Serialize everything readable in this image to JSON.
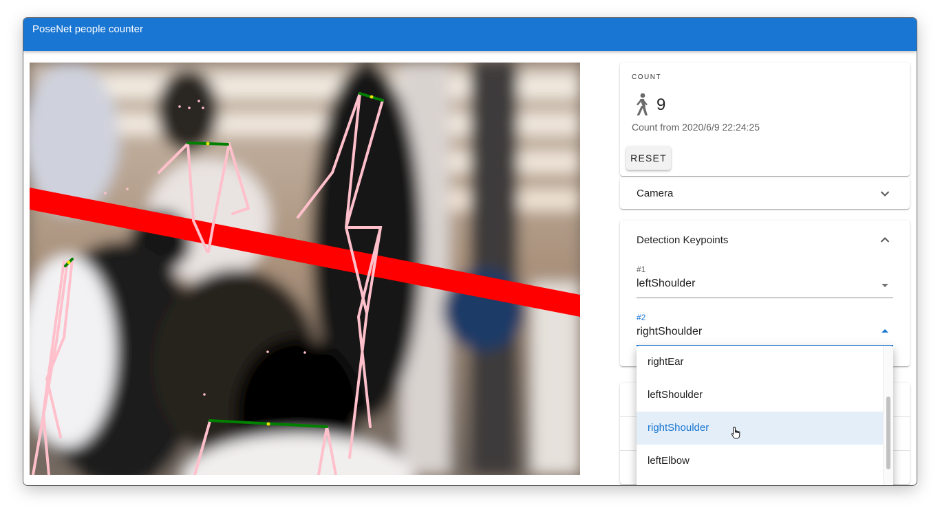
{
  "app": {
    "title": "PoseNet people counter"
  },
  "count_card": {
    "overline": "COUNT",
    "icon": "walking-person-icon",
    "count": "9",
    "count_from": "Count from 2020/6/9 22:24:25",
    "reset_label": "RESET"
  },
  "camera_section": {
    "title": "Camera",
    "expanded": false,
    "icon": "chevron-down-icon"
  },
  "keypoints_section": {
    "title": "Detection Keypoints",
    "expanded": true,
    "icon": "chevron-up-icon",
    "fields": [
      {
        "label": "#1",
        "value": "leftShoulder",
        "open": false
      },
      {
        "label": "#2",
        "value": "rightShoulder",
        "open": true
      }
    ]
  },
  "dropdown": {
    "options": [
      "rightEar",
      "leftShoulder",
      "rightShoulder",
      "leftElbow"
    ],
    "selected": "rightShoulder"
  },
  "colors": {
    "appbar": "#1976d2",
    "skeleton": "#ffc0cb",
    "shoulder_line": "#008000",
    "counting_line": "#ff0000",
    "selected_text": "#1976d2"
  }
}
